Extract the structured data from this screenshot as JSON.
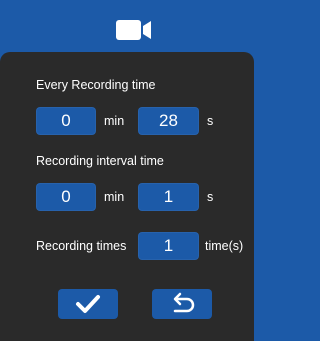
{
  "header": {
    "icon": "video-camera-icon"
  },
  "every_recording": {
    "label": "Every Recording time",
    "minutes": "0",
    "minutes_unit": "min",
    "seconds": "28",
    "seconds_unit": "s"
  },
  "recording_interval": {
    "label": "Recording interval time",
    "minutes": "0",
    "minutes_unit": "min",
    "seconds": "1",
    "seconds_unit": "s"
  },
  "recording_times": {
    "label": "Recording times",
    "value": "1",
    "unit": "time(s)"
  },
  "actions": {
    "confirm_icon": "checkmark-icon",
    "back_icon": "return-icon"
  },
  "colors": {
    "accent": "#1c5aa8",
    "panel": "#2a2a2a",
    "text": "#ffffff"
  }
}
